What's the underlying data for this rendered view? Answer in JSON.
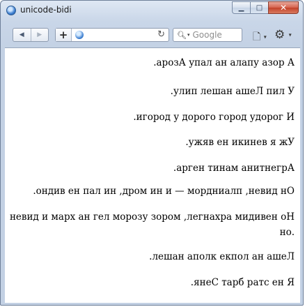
{
  "window": {
    "title": "unicode-bidi",
    "minimize_symbol": "▁",
    "maximize_symbol": "□",
    "close_symbol": "✕"
  },
  "toolbar": {
    "back_symbol": "◀",
    "forward_symbol": "▶",
    "plus_symbol": "+",
    "reload_symbol": "↻",
    "search_placeholder": "Google",
    "page_symbol": "🗋",
    "tools_symbol": "⚙",
    "caret": "▾"
  },
  "content": {
    "lines": [
      "арозА упал ан алапу азор А",
      "улип лешан ашеЛ пил У",
      "игород у дорого город удорог И",
      "ужяв ен икинев я жУ",
      "арген тинам анитнегрА",
      "ондив ен пал ин ,дром ин и — мордниалп ,невид нО",
      "невид и марх ан гел морозу зором ,легнахра мидивен оН",
      "но.",
      "лешан аполк екпол ан ашеЛ",
      "янеС тарб ратс ен Я"
    ],
    "line_ends": [
      ".",
      ".",
      ".",
      ".",
      ".",
      ".",
      "",
      "",
      ".",
      "."
    ]
  },
  "colors": {
    "frame": "#c9d6e8",
    "close": "#c2422a",
    "page_bg": "#ffffff"
  },
  "icons": [
    "app-icon",
    "back-icon",
    "forward-icon",
    "plus-icon",
    "globe-icon",
    "reload-icon",
    "search-icon",
    "page-menu-icon",
    "gear-icon"
  ]
}
